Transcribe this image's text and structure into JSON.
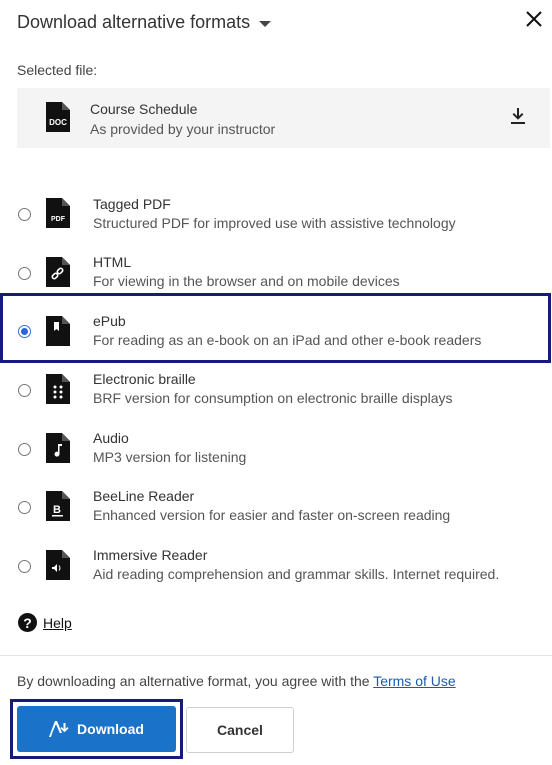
{
  "header": {
    "title": "Download alternative formats",
    "caret_icon": "chevron-down-icon",
    "close_icon": "close-icon"
  },
  "selected_label": "Selected file:",
  "file": {
    "name": "Course Schedule",
    "subtitle": "As provided by your instructor",
    "type_label": "DOC",
    "download_icon": "download-icon"
  },
  "formats": [
    {
      "name": "Tagged PDF",
      "desc": "Structured PDF for improved use with assistive technology",
      "icon": "pdf-file-icon",
      "icon_label": "PDF",
      "selected": false
    },
    {
      "name": "HTML",
      "desc": "For viewing in the browser and on mobile devices",
      "icon": "html-link-file-icon",
      "selected": false
    },
    {
      "name": "ePub",
      "desc": "For reading as an e-book on an iPad and other e-book readers",
      "icon": "epub-book-icon",
      "selected": true
    },
    {
      "name": "Electronic braille",
      "desc": "BRF version for consumption on electronic braille displays",
      "icon": "braille-file-icon",
      "selected": false
    },
    {
      "name": "Audio",
      "desc": "MP3 version for listening",
      "icon": "audio-file-icon",
      "selected": false
    },
    {
      "name": "BeeLine Reader",
      "desc": "Enhanced version for easier and faster on-screen reading",
      "icon": "beeline-file-icon",
      "icon_label": "B",
      "selected": false
    },
    {
      "name": "Immersive Reader",
      "desc": "Aid reading comprehension and grammar skills. Internet required.",
      "icon": "immersive-reader-icon",
      "selected": false
    }
  ],
  "help": {
    "label": "Help",
    "glyph": "?"
  },
  "footer": {
    "agree_text": "By downloading an alternative format, you agree with the ",
    "terms_link": "Terms of Use"
  },
  "buttons": {
    "download": "Download",
    "cancel": "Cancel"
  },
  "colors": {
    "primary": "#1a73c8",
    "focus_outline": "#141b7a",
    "link": "#1f5aa6"
  }
}
